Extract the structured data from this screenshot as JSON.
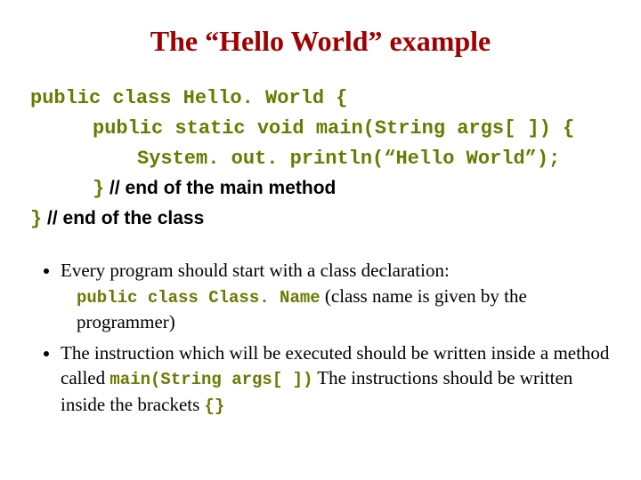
{
  "title": "The “Hello World” example",
  "code": {
    "line1": "public class Hello. World {",
    "line2": "public static void main(String args[ ]) {",
    "line3": "System. out. println(“Hello World”);",
    "line4_brace": "}",
    "line4_comment": " // end of the main method",
    "line5_brace": "}",
    "line5_comment": " // end of the class"
  },
  "bullets": {
    "b1_a": "Every program should start with a class declaration:",
    "b1_code": "public class Class. Name",
    "b1_b": "  (class name is given by the programmer)",
    "b2_a": "The instruction which will be executed should be written inside a method called ",
    "b2_code1": "main(String args[ ])",
    "b2_b": " The instructions should be written inside the brackets ",
    "b2_code2": "{}"
  }
}
